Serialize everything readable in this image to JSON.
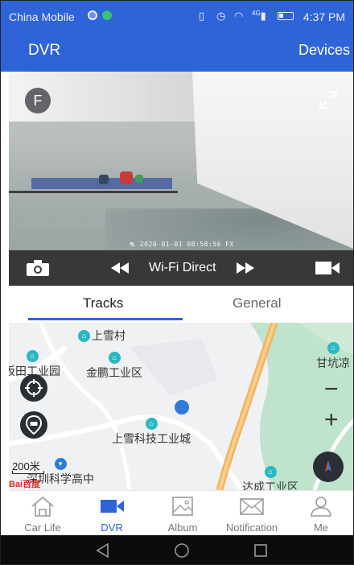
{
  "status_bar": {
    "carrier": "China Mobile",
    "time": "4:37 PM",
    "network_label": "4G"
  },
  "app_bar": {
    "title": "DVR",
    "devices_label": "Devices"
  },
  "video": {
    "camera_badge": "F",
    "timestamp": "2020-01-01 08:58:56 FX"
  },
  "controls": {
    "mode_label": "Wi-Fi Direct"
  },
  "tabs": [
    {
      "label": "Tracks",
      "active": true
    },
    {
      "label": "General",
      "active": false
    }
  ],
  "map": {
    "pois": [
      "上雪村",
      "坂田工业园",
      "金鹏工业区",
      "甘坑凉",
      "上雪科技工业城",
      "深圳科学高中",
      "达成工业区"
    ],
    "scale_label": "200米",
    "logo": "Bai百度"
  },
  "bottom_nav": [
    {
      "label": "Car Life",
      "icon": "home-icon",
      "active": false
    },
    {
      "label": "DVR",
      "icon": "video-camera-icon",
      "active": true
    },
    {
      "label": "Album",
      "icon": "image-icon",
      "active": false
    },
    {
      "label": "Notification",
      "icon": "mail-icon",
      "active": false
    },
    {
      "label": "Me",
      "icon": "person-icon",
      "active": false
    }
  ],
  "colors": {
    "primary": "#2f63d8",
    "control_bar": "#383838",
    "map_bg": "#f0f1f3",
    "road_orange": "#f4b45c",
    "park_green": "#bfe3cc"
  }
}
